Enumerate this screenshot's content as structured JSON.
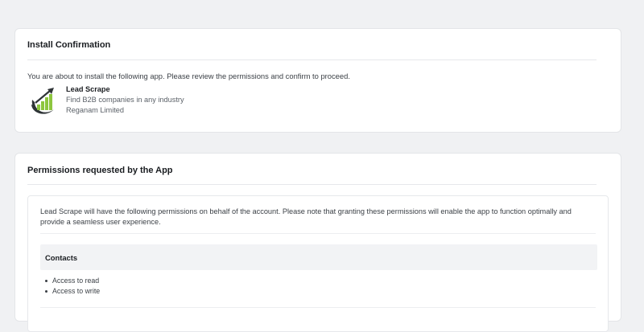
{
  "install": {
    "title": "Install Confirmation",
    "intro": "You are about to install the following app. Please review the permissions and confirm to proceed.",
    "app": {
      "name": "Lead Scrape",
      "description": "Find B2B companies in any industry",
      "vendor": "Reganam Limited",
      "logo_icon": "growth-chart-logo-icon",
      "logo_colors": {
        "ring": "#2f3437",
        "bars": "#8dc63f",
        "arrow": "#2f3437"
      }
    }
  },
  "permissions": {
    "title": "Permissions requested by the App",
    "intro": "Lead Scrape will have the following permissions on behalf of the account. Please note that granting these permissions will enable the app to function optimally and provide a seamless user experience.",
    "groups": [
      {
        "name": "Contacts",
        "items": [
          "Access to read",
          "Access to write"
        ]
      }
    ]
  },
  "colors": {
    "page_background": "#f0f1f3",
    "card_background": "#ffffff",
    "group_header_background": "#f2f3f5"
  }
}
